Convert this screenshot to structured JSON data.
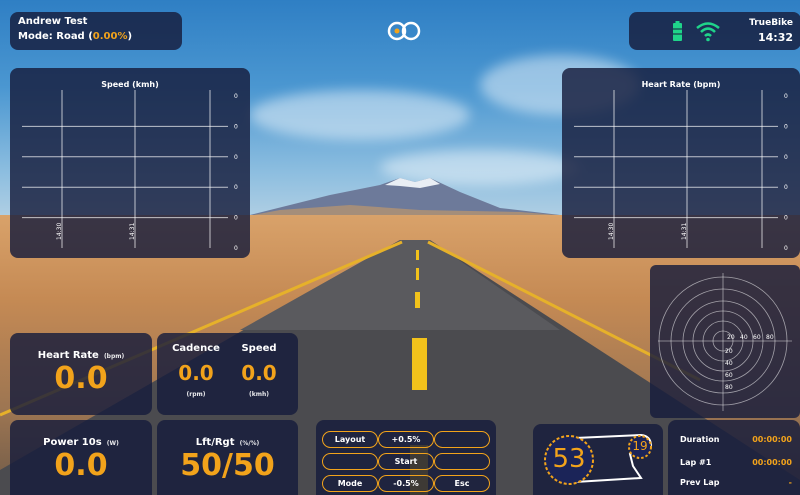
{
  "user": {
    "name": "Andrew Test",
    "mode_prefix": "Mode: Road (",
    "mode_value": "0.00%",
    "mode_suffix": ")"
  },
  "status": {
    "app_name": "TrueBike",
    "time": "14:32",
    "battery_icon": "battery-icon",
    "wifi_icon": "wifi-icon",
    "logo_icon": "bike-logo-icon"
  },
  "speed_chart": {
    "title": "Speed (kmh)",
    "y_ticks": [
      "0",
      "0",
      "0",
      "0",
      "0",
      "0"
    ],
    "x_ticks": [
      "14:30",
      "14:31"
    ]
  },
  "hr_chart": {
    "title": "Heart Rate (bpm)",
    "y_ticks": [
      "0",
      "0",
      "0",
      "0",
      "0",
      "0"
    ],
    "x_ticks": [
      "14:30",
      "14:31"
    ]
  },
  "radar": {
    "ticks": [
      "20",
      "40",
      "60",
      "80"
    ],
    "ring_labels": [
      "20",
      "40",
      "60",
      "80"
    ]
  },
  "metrics": {
    "heart_rate": {
      "label": "Heart Rate",
      "unit": "(bpm)",
      "value": "0.0"
    },
    "cadence": {
      "label": "Cadence",
      "unit": "(rpm)",
      "value": "0.0"
    },
    "speed": {
      "label": "Speed",
      "unit": "(kmh)",
      "value": "0.0"
    },
    "power": {
      "label": "Power 10s",
      "unit": "(W)",
      "value": "0.0"
    },
    "balance": {
      "label": "Lft/Rgt",
      "unit": "(%/%)",
      "value": "50/50"
    }
  },
  "controls": {
    "layout": "Layout",
    "plus": "+0.5%",
    "start": "Start",
    "mode": "Mode",
    "minus": "-0.5%",
    "esc": "Esc"
  },
  "gears": {
    "front": "53",
    "rear": "19"
  },
  "lap": {
    "duration_label": "Duration",
    "duration_value": "00:00:00",
    "lap_label": "Lap #1",
    "lap_value": "00:00:00",
    "prev_label": "Prev Lap",
    "prev_value": "-"
  },
  "colors": {
    "accent": "#f2a31b",
    "panel": "#161c3c"
  }
}
